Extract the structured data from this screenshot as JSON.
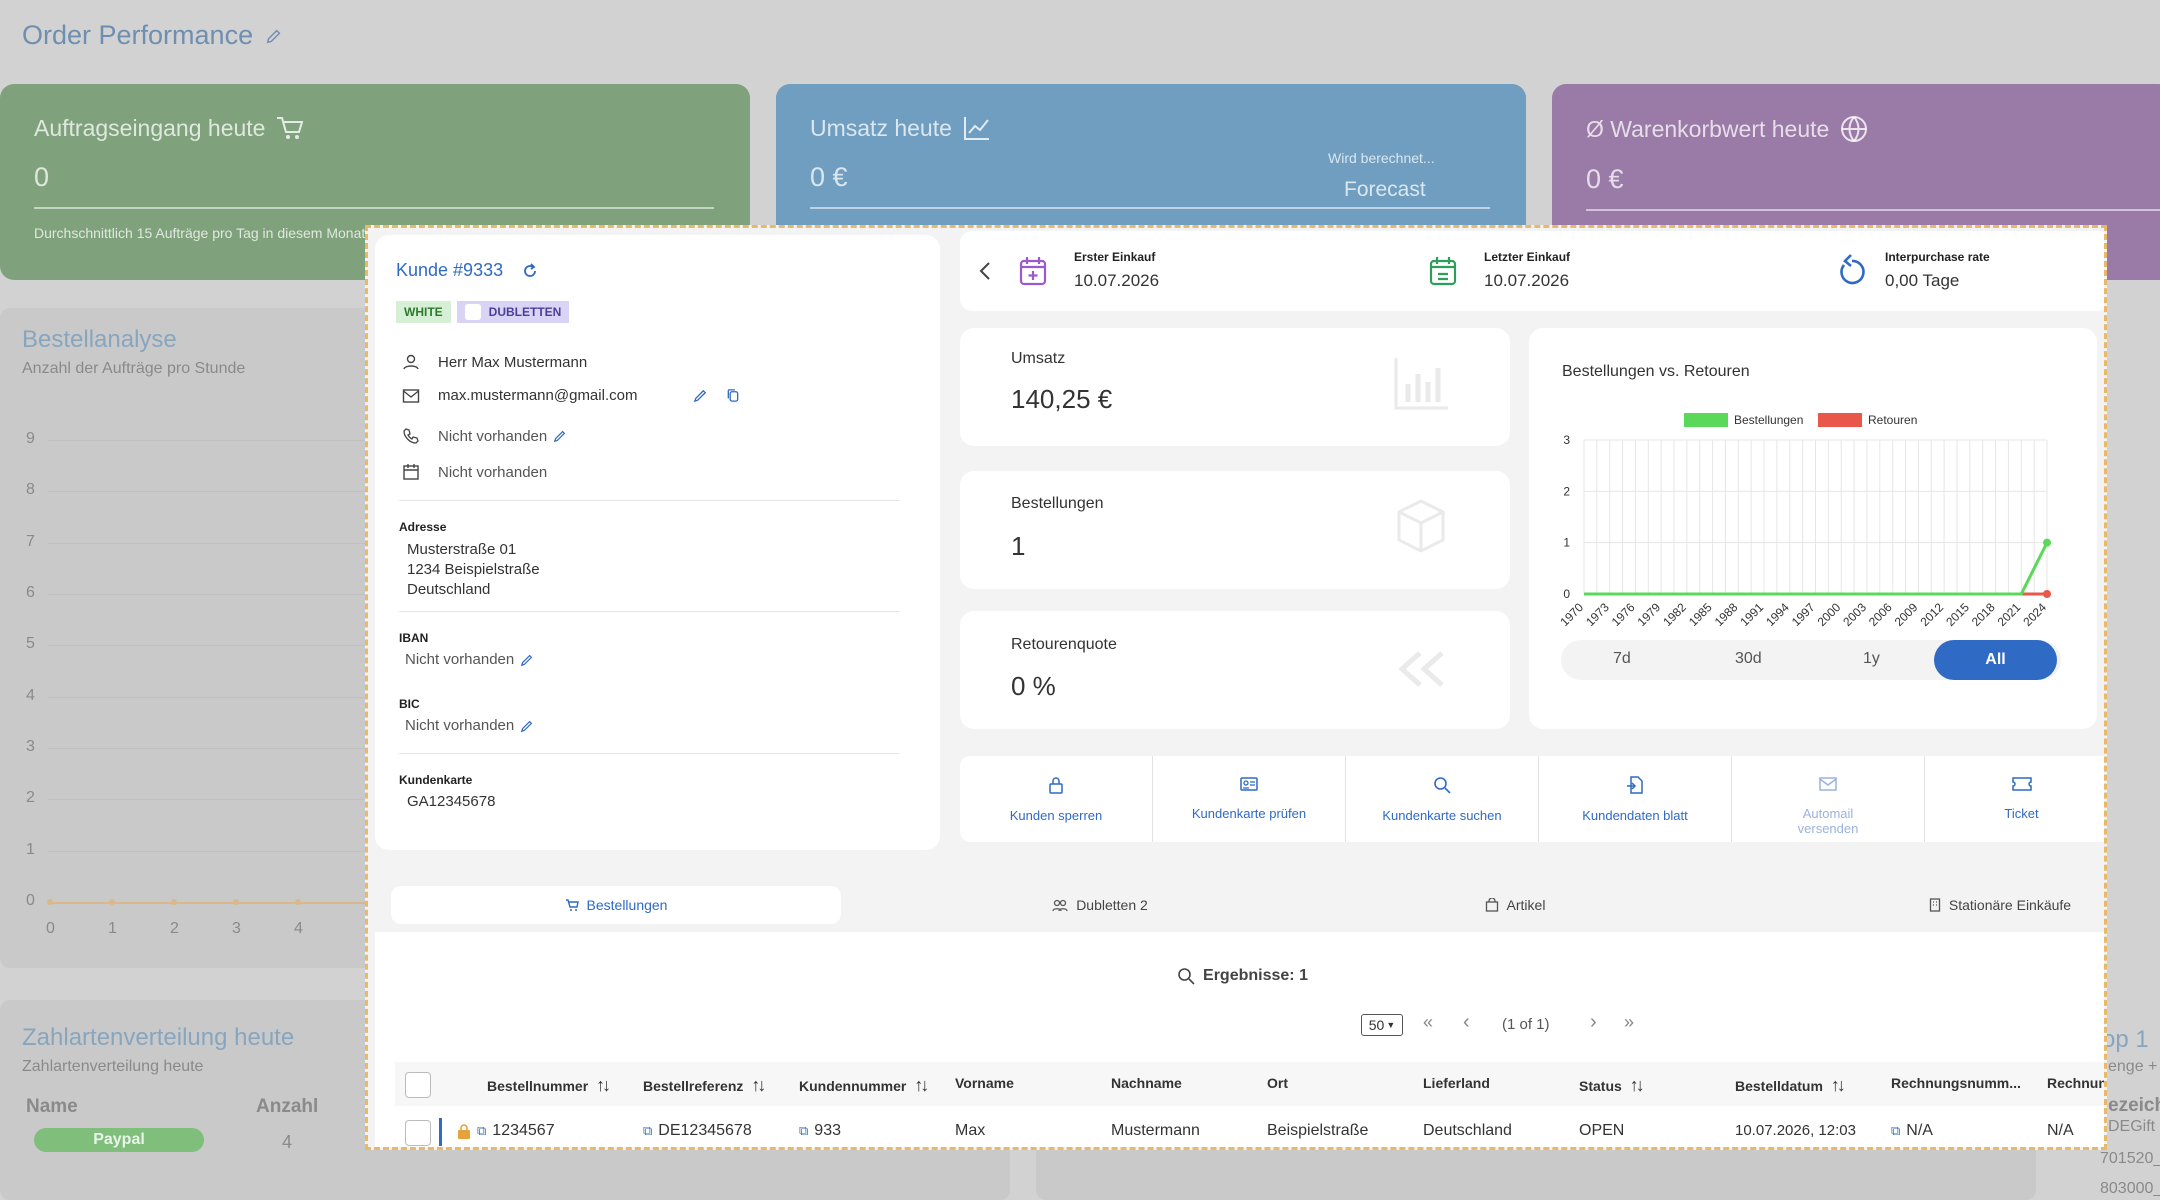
{
  "background": {
    "title": "Order Performance",
    "kpis": [
      {
        "label": "Auftragseingang heute",
        "value": "0",
        "sub": "Durchschnittlich 15 Aufträge pro Tag in diesem Monat"
      },
      {
        "label": "Umsatz heute",
        "value": "0 €",
        "forecast_note": "Wird berechnet...",
        "forecast": "Forecast"
      },
      {
        "label": "Ø Warenkorbwert heute",
        "value": "0 €"
      }
    ],
    "bestellanalyse": {
      "title": "Bestellanalyse",
      "subtitle": "Anzahl der Aufträge pro Stunde",
      "yticks": [
        "0",
        "1",
        "2",
        "3",
        "4",
        "5",
        "6",
        "7",
        "8",
        "9"
      ],
      "xticks": [
        "0",
        "1",
        "2",
        "3",
        "4"
      ]
    },
    "zahlarten": {
      "title": "Zahlartenverteilung heute",
      "subtitle": "Zahlartenverteilung heute",
      "col_name": "Name",
      "col_count": "Anzahl",
      "row_name": "Paypal",
      "row_count": "4"
    },
    "right_peek": {
      "title": "op 1",
      "sub": "enge +",
      "col": "ezeich",
      "rows": [
        "DEGift",
        "701520_",
        "803000_"
      ]
    }
  },
  "customer": {
    "title": "Kunde #9333",
    "badge_white": "WHITE",
    "badge_dubletten": "DUBLETTEN",
    "name": "Herr Max Mustermann",
    "email": "max.mustermann@gmail.com",
    "phone": "Nicht vorhanden",
    "birthday": "Nicht vorhanden",
    "address_label": "Adresse",
    "address_lines": [
      "Musterstraße 01",
      "1234 Beispielstraße",
      "Deutschland"
    ],
    "iban_label": "IBAN",
    "iban": "Nicht vorhanden",
    "bic_label": "BIC",
    "bic": "Nicht vorhanden",
    "card_label": "Kundenkarte",
    "card": "GA12345678"
  },
  "topbar": {
    "first_label": "Erster Einkauf",
    "first_value": "10.07.2026",
    "last_label": "Letzter Einkauf",
    "last_value": "10.07.2026",
    "rate_label": "Interpurchase rate",
    "rate_value": "0,00 Tage"
  },
  "stats": [
    {
      "label": "Umsatz",
      "value": "140,25 €"
    },
    {
      "label": "Bestellungen",
      "value": "1"
    },
    {
      "label": "Retourenquote",
      "value": "0 %"
    }
  ],
  "chart_data": {
    "type": "line",
    "title": "Bestellungen vs. Retouren",
    "x": [
      "1970",
      "1973",
      "1976",
      "1979",
      "1982",
      "1985",
      "1988",
      "1991",
      "1994",
      "1997",
      "2000",
      "2003",
      "2006",
      "2009",
      "2012",
      "2015",
      "2018",
      "2021",
      "2024"
    ],
    "series": [
      {
        "name": "Bestellungen",
        "color": "#5ad85a",
        "values": [
          0,
          0,
          0,
          0,
          0,
          0,
          0,
          0,
          0,
          0,
          0,
          0,
          0,
          0,
          0,
          0,
          0,
          0,
          1
        ]
      },
      {
        "name": "Retouren",
        "color": "#e8574a",
        "values": [
          0,
          0,
          0,
          0,
          0,
          0,
          0,
          0,
          0,
          0,
          0,
          0,
          0,
          0,
          0,
          0,
          0,
          0,
          0
        ]
      }
    ],
    "ylim": [
      0,
      3
    ],
    "yticks": [
      "0",
      "1",
      "2",
      "3"
    ],
    "legend": "top-center",
    "grid": true
  },
  "ranges": [
    "7d",
    "30d",
    "1y",
    "All"
  ],
  "active_range": "All",
  "actions": [
    "Kunden sperren",
    "Kundenkarte prüfen",
    "Kundenkarte suchen",
    "Kundendaten blatt",
    "Automail versenden",
    "Ticket"
  ],
  "tabs": [
    "Bestellungen",
    "Dubletten 2",
    "Artikel",
    "Stationäre Einkäufe"
  ],
  "results": "Ergebnisse: 1",
  "pager": {
    "page_size": "50",
    "info": "(1 of 1)",
    "first": "«",
    "prev": "‹",
    "next": "›",
    "last": "»"
  },
  "table": {
    "headers": [
      "Bestellnummer",
      "Bestellreferenz",
      "Kundennummer",
      "Vorname",
      "Nachname",
      "Ort",
      "Lieferland",
      "Status",
      "Bestelldatum",
      "Rechnungsnumm...",
      "Rechnung"
    ],
    "row": [
      "1234567",
      "DE12345678",
      "933",
      "Max",
      "Mustermann",
      "Beispielstraße",
      "Deutschland",
      "OPEN",
      "10.07.2026, 12:03",
      "N/A",
      "N/A"
    ]
  },
  "colors": {
    "accent": "#2f6ac4",
    "badge_white_bg": "#d6f0d6",
    "badge_dub_bg": "#d9d3f5",
    "purple_icon": "#9b59d0",
    "green_icon": "#2e9e5b"
  }
}
